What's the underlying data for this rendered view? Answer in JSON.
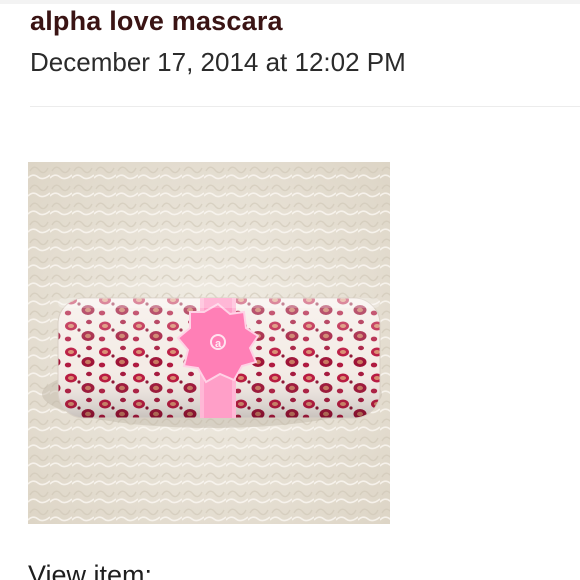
{
  "post": {
    "title": "alpha love mascara",
    "timestamp": "December 17, 2014 at 12:02 PM",
    "view_item_label": "View item:"
  },
  "photo": {
    "subject": "leopard-print-mascara-tube",
    "accent_color": "#ff8fbd",
    "background_color": "#ebe5da"
  }
}
